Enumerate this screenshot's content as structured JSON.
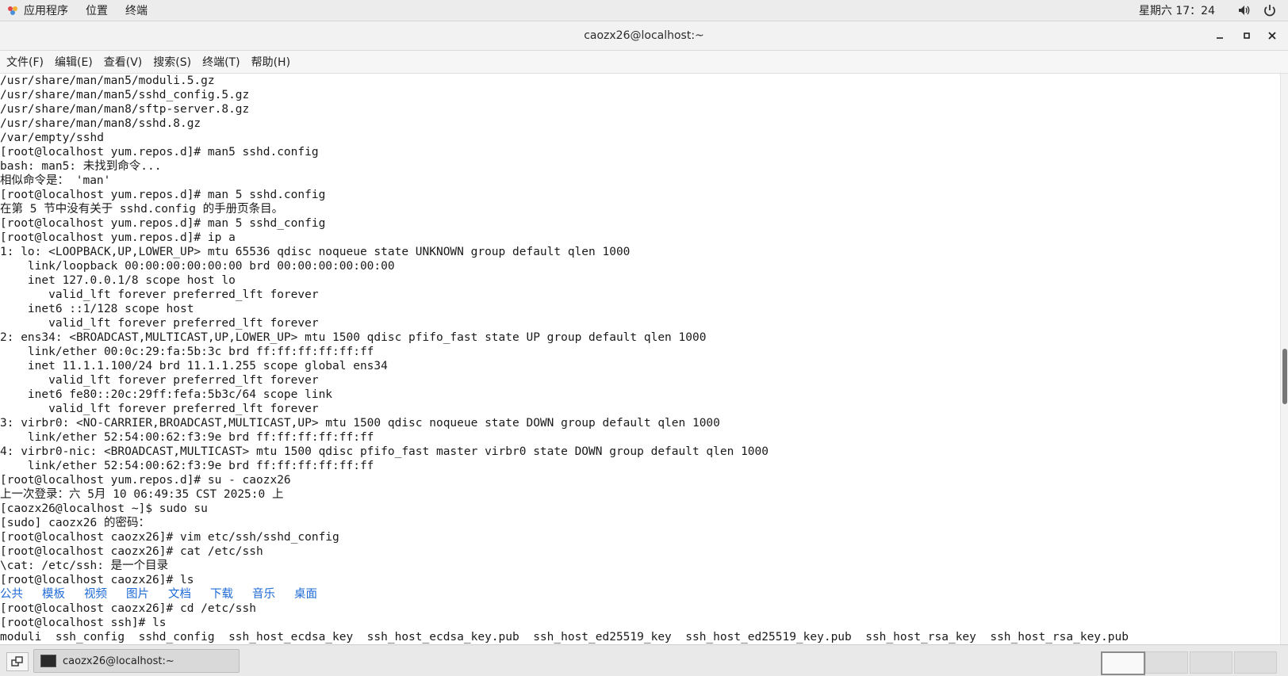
{
  "topbar": {
    "apps_label": "应用程序",
    "places_label": "位置",
    "terminal_label": "终端",
    "clock": "星期六 17：24"
  },
  "window": {
    "title": "caozx26@localhost:~"
  },
  "menubar": {
    "items": [
      "文件(F)",
      "编辑(E)",
      "查看(V)",
      "搜索(S)",
      "终端(T)",
      "帮助(H)"
    ]
  },
  "terminal": {
    "lines": [
      "/usr/share/man/man5/moduli.5.gz",
      "/usr/share/man/man5/sshd_config.5.gz",
      "/usr/share/man/man8/sftp-server.8.gz",
      "/usr/share/man/man8/sshd.8.gz",
      "/var/empty/sshd",
      "[root@localhost yum.repos.d]# man5 sshd.config",
      "bash: man5: 未找到命令...",
      "相似命令是： 'man'",
      "[root@localhost yum.repos.d]# man 5 sshd.config",
      "在第 5 节中没有关于 sshd.config 的手册页条目。",
      "[root@localhost yum.repos.d]# man 5 sshd_config",
      "[root@localhost yum.repos.d]# ip a",
      "1: lo: <LOOPBACK,UP,LOWER_UP> mtu 65536 qdisc noqueue state UNKNOWN group default qlen 1000",
      "    link/loopback 00:00:00:00:00:00 brd 00:00:00:00:00:00",
      "    inet 127.0.0.1/8 scope host lo",
      "       valid_lft forever preferred_lft forever",
      "    inet6 ::1/128 scope host",
      "       valid_lft forever preferred_lft forever",
      "2: ens34: <BROADCAST,MULTICAST,UP,LOWER_UP> mtu 1500 qdisc pfifo_fast state UP group default qlen 1000",
      "    link/ether 00:0c:29:fa:5b:3c brd ff:ff:ff:ff:ff:ff",
      "    inet 11.1.1.100/24 brd 11.1.1.255 scope global ens34",
      "       valid_lft forever preferred_lft forever",
      "    inet6 fe80::20c:29ff:fefa:5b3c/64 scope link",
      "       valid_lft forever preferred_lft forever",
      "3: virbr0: <NO-CARRIER,BROADCAST,MULTICAST,UP> mtu 1500 qdisc noqueue state DOWN group default qlen 1000",
      "    link/ether 52:54:00:62:f3:9e brd ff:ff:ff:ff:ff:ff",
      "4: virbr0-nic: <BROADCAST,MULTICAST> mtu 1500 qdisc pfifo_fast master virbr0 state DOWN group default qlen 1000",
      "    link/ether 52:54:00:62:f3:9e brd ff:ff:ff:ff:ff:ff",
      "[root@localhost yum.repos.d]# su - caozx26",
      "上一次登录：六 5月 10 06:49:35 CST 2025:0 上",
      "[caozx26@localhost ~]$ sudo su",
      "[sudo] caozx26 的密码：",
      "[root@localhost caozx26]# vim etc/ssh/sshd_config",
      "[root@localhost caozx26]# cat /etc/ssh",
      "\\cat: /etc/ssh: 是一个目录",
      "[root@localhost caozx26]# ls"
    ],
    "dir_listing": [
      "公共",
      "模板",
      "视频",
      "图片",
      "文档",
      "下载",
      "音乐",
      "桌面"
    ],
    "lines_after": [
      "[root@localhost caozx26]# cd /etc/ssh",
      "[root@localhost ssh]# ls",
      "moduli  ssh_config  sshd_config  ssh_host_ecdsa_key  ssh_host_ecdsa_key.pub  ssh_host_ed25519_key  ssh_host_ed25519_key.pub  ssh_host_rsa_key  ssh_host_rsa_key.pub"
    ],
    "dir_color": "#1e6bd6"
  },
  "taskbar": {
    "task_label": "caozx26@localhost:~"
  }
}
